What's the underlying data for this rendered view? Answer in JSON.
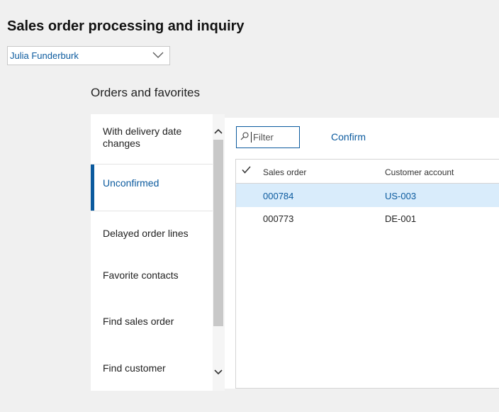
{
  "header": {
    "title": "Sales order processing and inquiry",
    "user_selector": {
      "selected": "Julia Funderburk"
    }
  },
  "section": {
    "title": "Orders and favorites"
  },
  "tabs": [
    {
      "label": "With delivery date changes"
    },
    {
      "label": "Unconfirmed",
      "selected": true
    },
    {
      "label": "Delayed order lines"
    },
    {
      "label": "Favorite contacts"
    },
    {
      "label": "Find sales order"
    },
    {
      "label": "Find customer"
    }
  ],
  "panel": {
    "filter": {
      "placeholder": "Filter",
      "value": ""
    },
    "confirm_label": "Confirm",
    "grid": {
      "columns": [
        "Sales order",
        "Customer account"
      ],
      "rows": [
        {
          "sales_order": "000784",
          "customer_account": "US-003",
          "selected": true
        },
        {
          "sales_order": "000773",
          "customer_account": "DE-001",
          "selected": false
        }
      ]
    }
  },
  "colors": {
    "accent": "#0b5a9e",
    "selected_row": "#d9ecfb",
    "background": "#f0f0f0"
  }
}
